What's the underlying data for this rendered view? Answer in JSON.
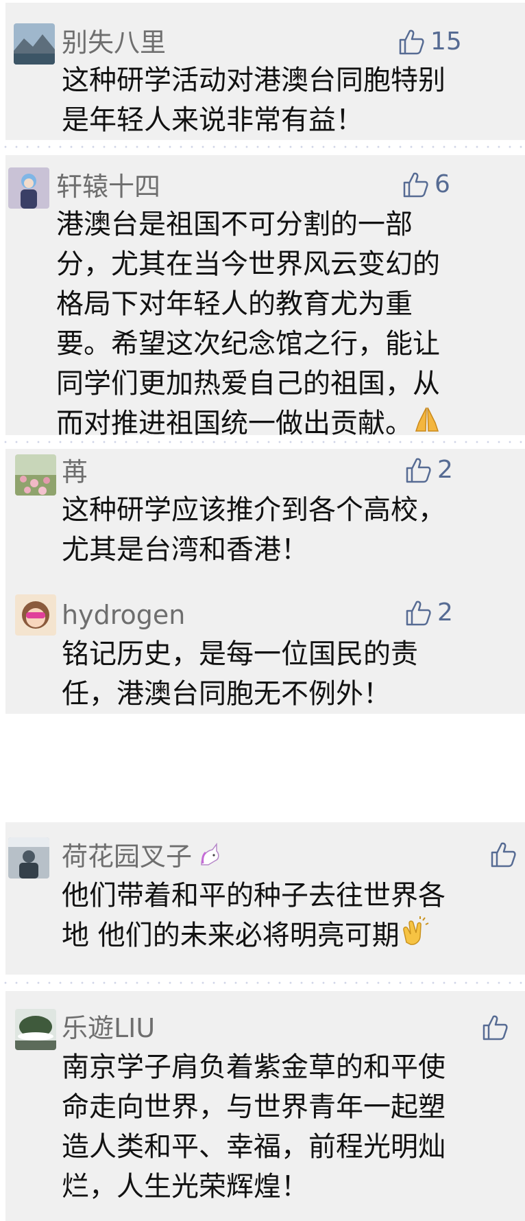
{
  "comments": [
    {
      "username": "别失八里",
      "likes": "15",
      "lines": [
        "这种研学活动对港澳台同胞特别",
        "是年轻人来说非常有益！"
      ]
    },
    {
      "username": "轩辕十四",
      "likes": "6",
      "lines": [
        "港澳台是祖国不可分割的一部",
        "分，尤其在当今世界风云变幻的",
        "格局下对年轻人的教育尤为重",
        "要。希望这次纪念馆之行，能让",
        "同学们更加热爱自己的祖国，从",
        "而对推进祖国统一做出贡献。"
      ],
      "trailing_emoji": "folded-hands-emoji"
    },
    {
      "username": "苒",
      "likes": "2",
      "lines": [
        "这种研学应该推介到各个高校，",
        "尤其是台湾和香港！"
      ]
    },
    {
      "username": "hydrogen",
      "likes": "2",
      "lines": [
        "铭记历史，是每一位国民的责",
        "任，港澳台同胞无不例外！"
      ]
    },
    {
      "username": "荷花园叉子",
      "name_emoji": "unicorn-emoji",
      "likes": "",
      "lines": [
        "他们带着和平的种子去往世界各",
        "地 他们的未来必将明亮可期"
      ],
      "trailing_emoji": "clapping-hands-emoji"
    },
    {
      "username": "乐遊LIU",
      "likes": "",
      "lines": [
        "南京学子肩负着紫金草的和平使",
        "命走向世界，与世界青年一起塑",
        "造人类和平、幸福，前程光明灿",
        "烂，人生光荣辉煌！"
      ]
    }
  ],
  "colors": {
    "card_bg": "#f0f0f0",
    "username": "#6e6e6e",
    "like_icon": "#566b93",
    "text": "#111111"
  }
}
